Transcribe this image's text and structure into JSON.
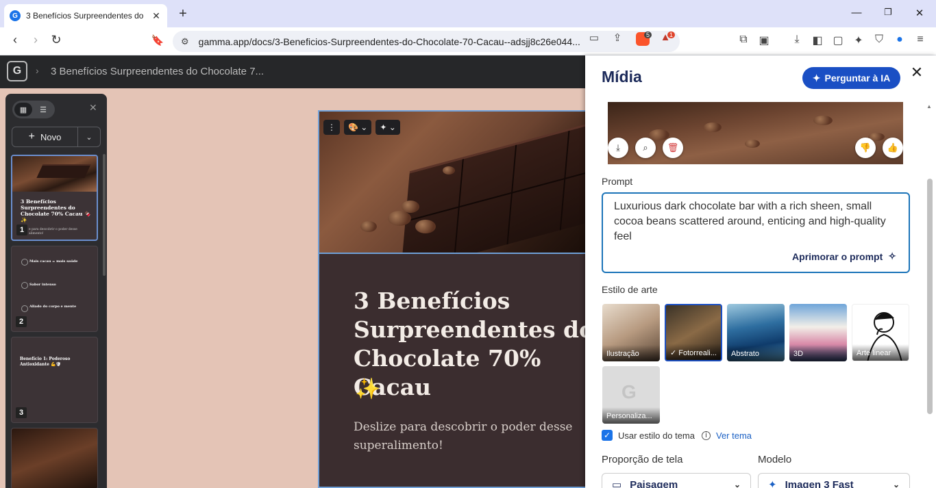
{
  "browser": {
    "tab_title": "3 Benefícios Surpreendentes do",
    "tab_favicon": "G",
    "url": "gamma.app/docs/3-Beneficios-Surpreendentes-do-Chocolate-70-Cacau--adsjj8c26e044...",
    "brave_badge": "5",
    "alert_badge": "1"
  },
  "app": {
    "logo": "G",
    "doc_title": "3 Benefícios Surpreendentes do Chocolate 7...",
    "new_button": "Novo",
    "thumbnails": [
      {
        "number": "1",
        "title": "3 Benefícios Surpreendentes do Chocolate 70% Cacau 🍫✨",
        "subtitle": "e para descobrir o poder desse alimento!"
      },
      {
        "number": "2",
        "items": [
          "Mais cacau = mais saúde",
          "Sabor intenso",
          "Aliado do corpo e mente"
        ]
      },
      {
        "number": "3",
        "title": "Benefício 1: Poderoso Antioxidante 💪🛡"
      }
    ]
  },
  "slide": {
    "title": "3 Benefícios\nSurpreendentes do\nChocolate 70% Cacau",
    "sparkle": "✨",
    "subtitle": "Deslize para descobrir o poder desse superalimento!"
  },
  "media_panel": {
    "title": "Mídia",
    "ask_ai": "Perguntar à IA",
    "prompt_label": "Prompt",
    "prompt_text": "Luxurious dark chocolate bar with a rich sheen, small cocoa beans scattered around, enticing and high-quality feel",
    "improve_prompt": "Aprimorar o prompt",
    "art_style_label": "Estilo de arte",
    "art_styles": [
      {
        "label": "Ilustração",
        "selected": false
      },
      {
        "label": "Fotorreali...",
        "selected": true
      },
      {
        "label": "Abstrato",
        "selected": false
      },
      {
        "label": "3D",
        "selected": false
      },
      {
        "label": "Arte linear",
        "selected": false
      },
      {
        "label": "Personaliza...",
        "selected": false
      }
    ],
    "use_theme_style": "Usar estilo do tema",
    "use_theme_checked": true,
    "view_theme": "Ver tema",
    "aspect_label": "Proporção de tela",
    "aspect_value": "Paisagem",
    "model_label": "Modelo",
    "model_value": "Imagen 3 Fast"
  },
  "colors": {
    "accent": "#1a4fc4",
    "canvas_bg": "#e4c4b6",
    "slide_bg": "#3b2d2f"
  }
}
